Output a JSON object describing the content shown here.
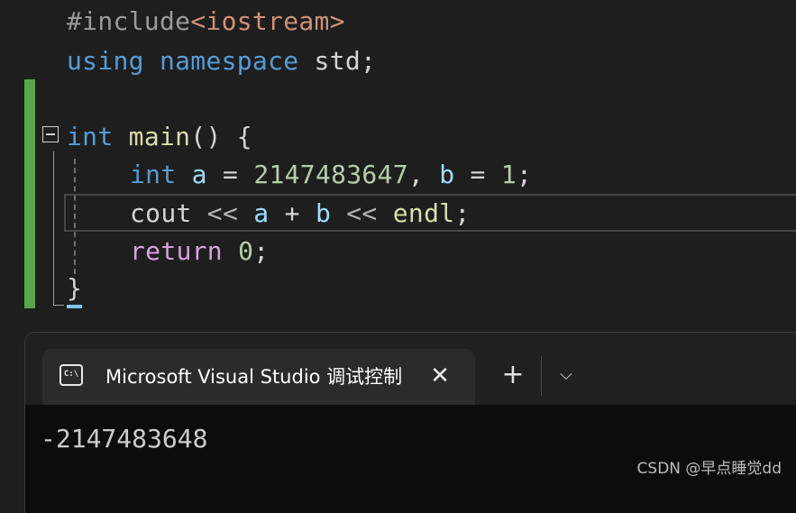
{
  "editor": {
    "lines": [
      {
        "tokens": [
          "#include",
          "<iostream>"
        ]
      },
      {
        "tokens": [
          "using",
          " ",
          "namespace",
          " std;"
        ]
      },
      {
        "tokens": []
      },
      {
        "tokens": [
          "int",
          " ",
          "main",
          "() {"
        ]
      },
      {
        "tokens": [
          "int",
          " ",
          "a",
          " = ",
          "2147483647",
          ", ",
          "b",
          " = ",
          "1",
          ";"
        ]
      },
      {
        "tokens": [
          "cout",
          " << ",
          "a",
          " + ",
          "b",
          " << ",
          "endl",
          ";"
        ]
      },
      {
        "tokens": [
          "return",
          " ",
          "0",
          ";"
        ]
      },
      {
        "tokens": [
          "}"
        ]
      }
    ]
  },
  "terminal": {
    "tab_title": "Microsoft Visual Studio 调试控制台",
    "tab_icon_glyph": "C:\\",
    "close_glyph": "✕",
    "new_tab_glyph": "+",
    "dropdown_glyph": "⌵",
    "output": "-2147483648"
  },
  "watermark": "CSDN @早点睡觉dd",
  "colors": {
    "keyword": "#569cd6",
    "control_keyword": "#d8a0df",
    "function": "#dcdcaa",
    "variable": "#9cdcfe",
    "number": "#b5cea8",
    "include_string": "#ce9178",
    "change_bar": "#57a64a"
  },
  "icons": [
    "collapse-minus-icon",
    "terminal-console-icon",
    "close-icon",
    "plus-icon",
    "chevron-down-icon"
  ]
}
